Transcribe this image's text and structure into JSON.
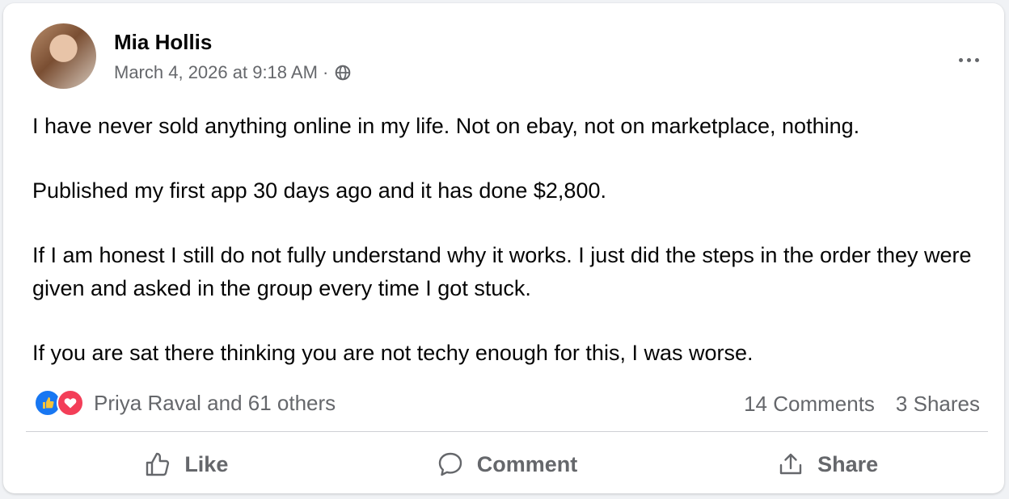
{
  "post": {
    "author": "Mia Hollis",
    "timestamp": "March 4, 2026 at 9:18 AM",
    "separator": "·",
    "audience_icon": "globe-icon",
    "body": [
      "I have never sold anything online in my life. Not on ebay, not on marketplace, nothing.",
      "Published my first app 30 days ago and it has done $2,800.",
      "If I am honest I still do not fully understand why it works. I just did the steps in the order they were given and asked in the group every time I got stuck.",
      "If you are sat there thinking you are not techy enough for this, I was worse."
    ]
  },
  "engagement": {
    "reaction_icons": [
      "like-reaction-icon",
      "love-reaction-icon"
    ],
    "reaction_summary": "Priya Raval and 61 others",
    "comments": "14 Comments",
    "shares": "3 Shares"
  },
  "actions": {
    "like_label": "Like",
    "comment_label": "Comment",
    "share_label": "Share"
  },
  "colors": {
    "like_blue": "#1877f2",
    "love_red": "#f33e58",
    "secondary_text": "#65676b"
  }
}
